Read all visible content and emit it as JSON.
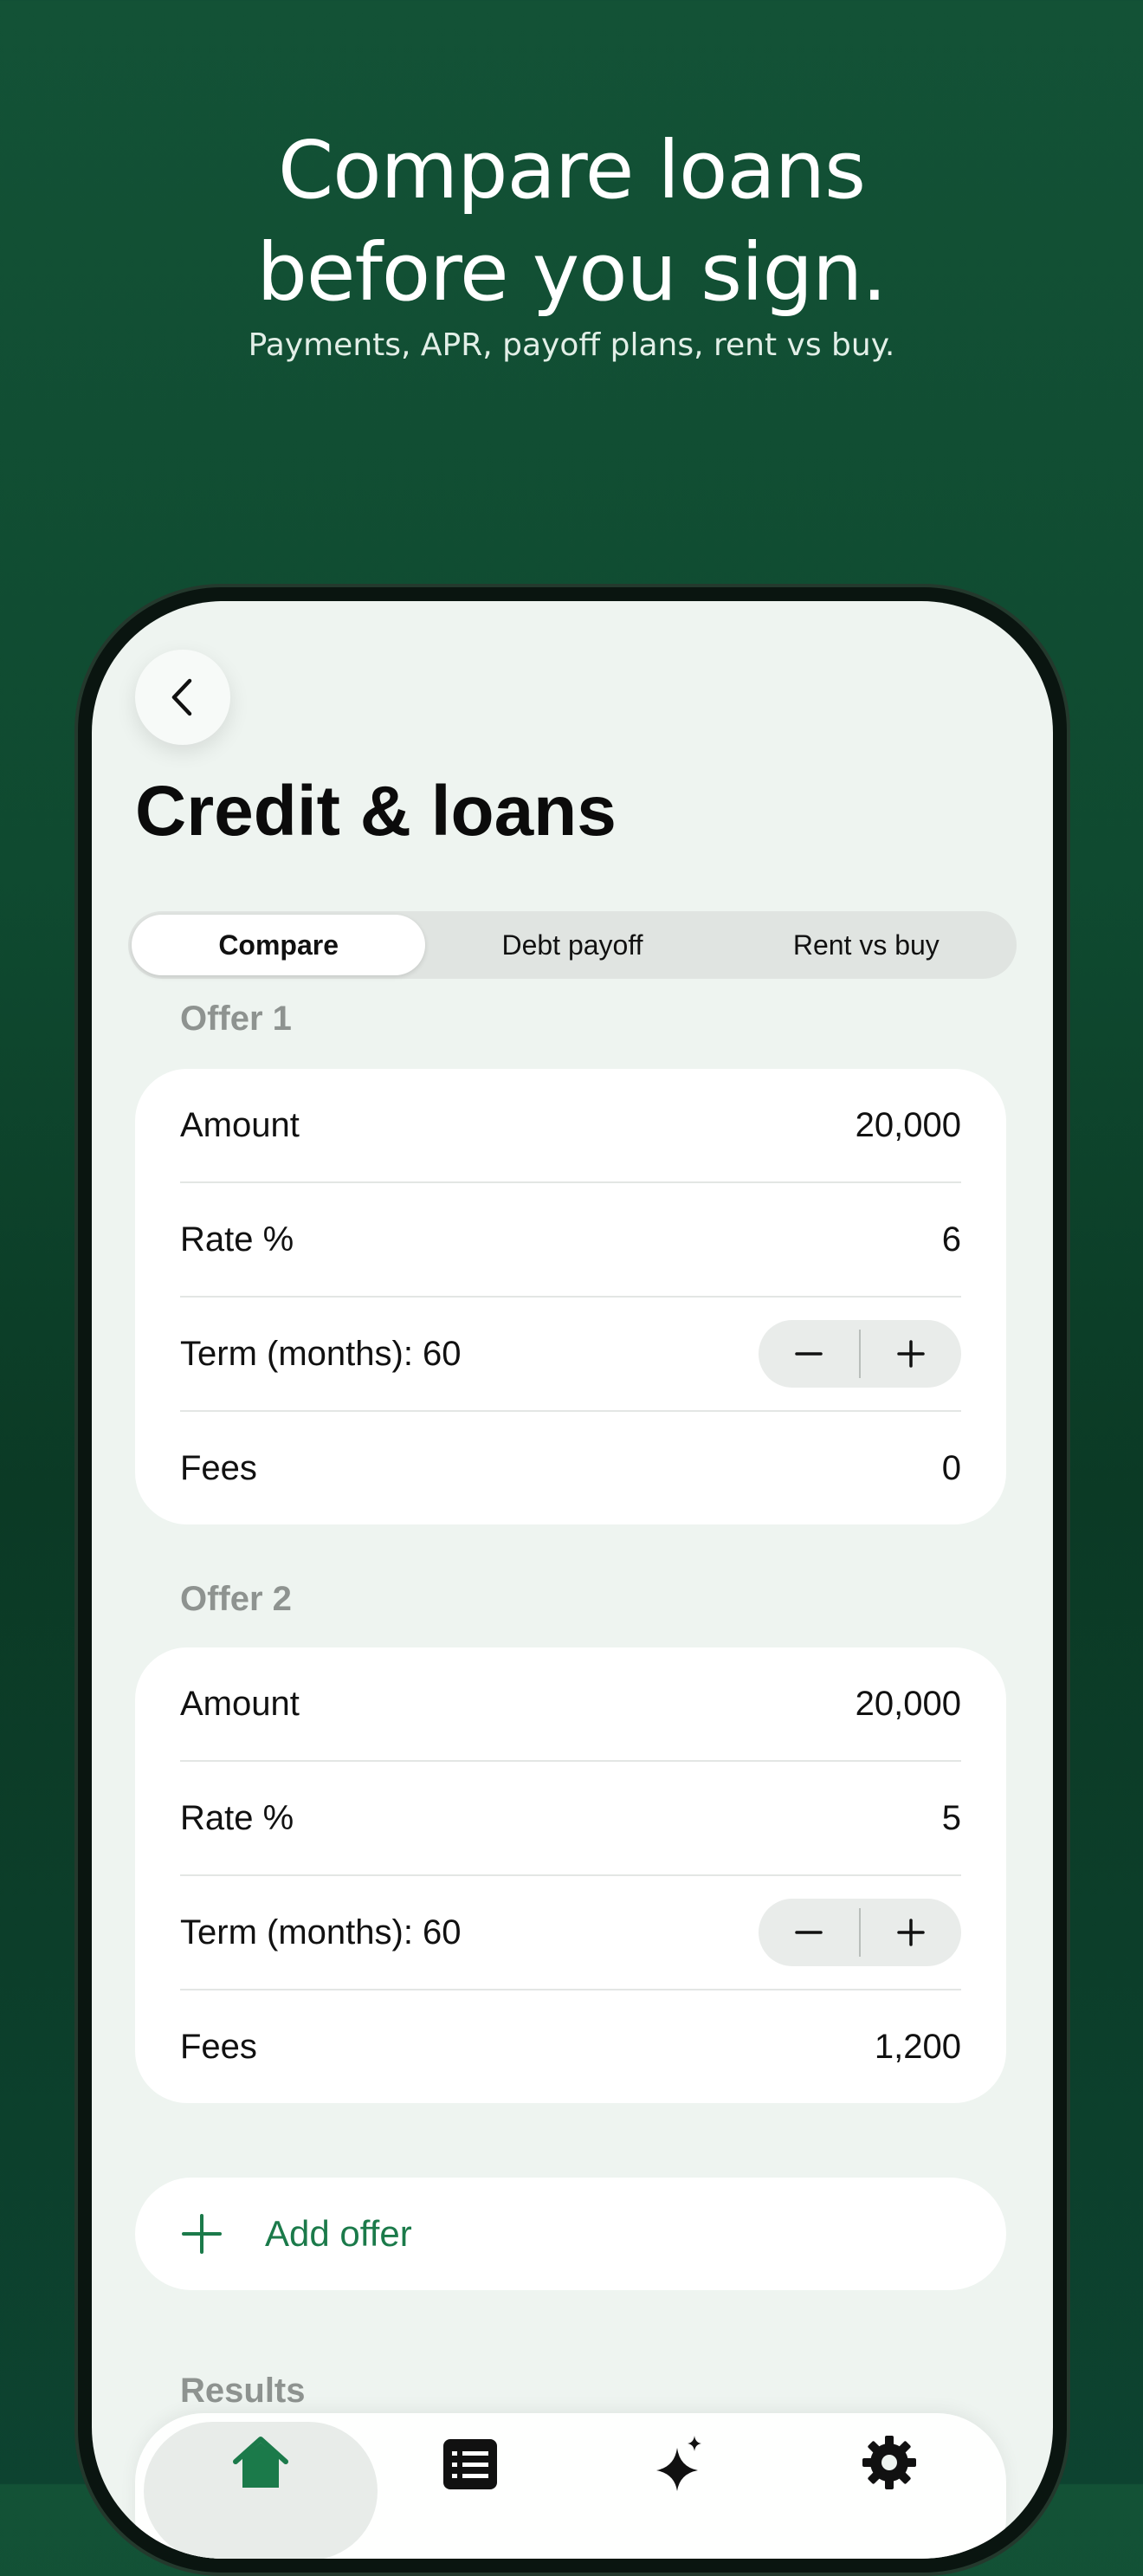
{
  "marketing": {
    "headline_line1": "Compare loans",
    "headline_line2": "before you sign.",
    "subhead": "Payments, APR, payoff plans, rent vs buy."
  },
  "screen": {
    "title": "Credit & loans",
    "back_icon": "chevron-left-icon",
    "segments": [
      {
        "label": "Compare",
        "active": true
      },
      {
        "label": "Debt payoff",
        "active": false
      },
      {
        "label": "Rent vs buy",
        "active": false
      }
    ],
    "offers": [
      {
        "label": "Offer 1",
        "amount_label": "Amount",
        "amount": "20,000",
        "rate_label": "Rate %",
        "rate": "6",
        "term_label": "Term (months): 60",
        "fees_label": "Fees",
        "fees": "0"
      },
      {
        "label": "Offer 2",
        "amount_label": "Amount",
        "amount": "20,000",
        "rate_label": "Rate %",
        "rate": "5",
        "term_label": "Term (months): 60",
        "fees_label": "Fees",
        "fees": "1,200"
      }
    ],
    "add_offer_label": "Add offer",
    "results_label": "Results",
    "tabs": [
      {
        "icon": "home-icon",
        "active": true
      },
      {
        "icon": "list-icon",
        "active": false
      },
      {
        "icon": "sparkles-icon",
        "active": false
      },
      {
        "icon": "gear-icon",
        "active": false
      }
    ]
  },
  "colors": {
    "accent": "#1b7a4a",
    "background_top": "#135236",
    "background_bottom": "#0b3a25"
  }
}
